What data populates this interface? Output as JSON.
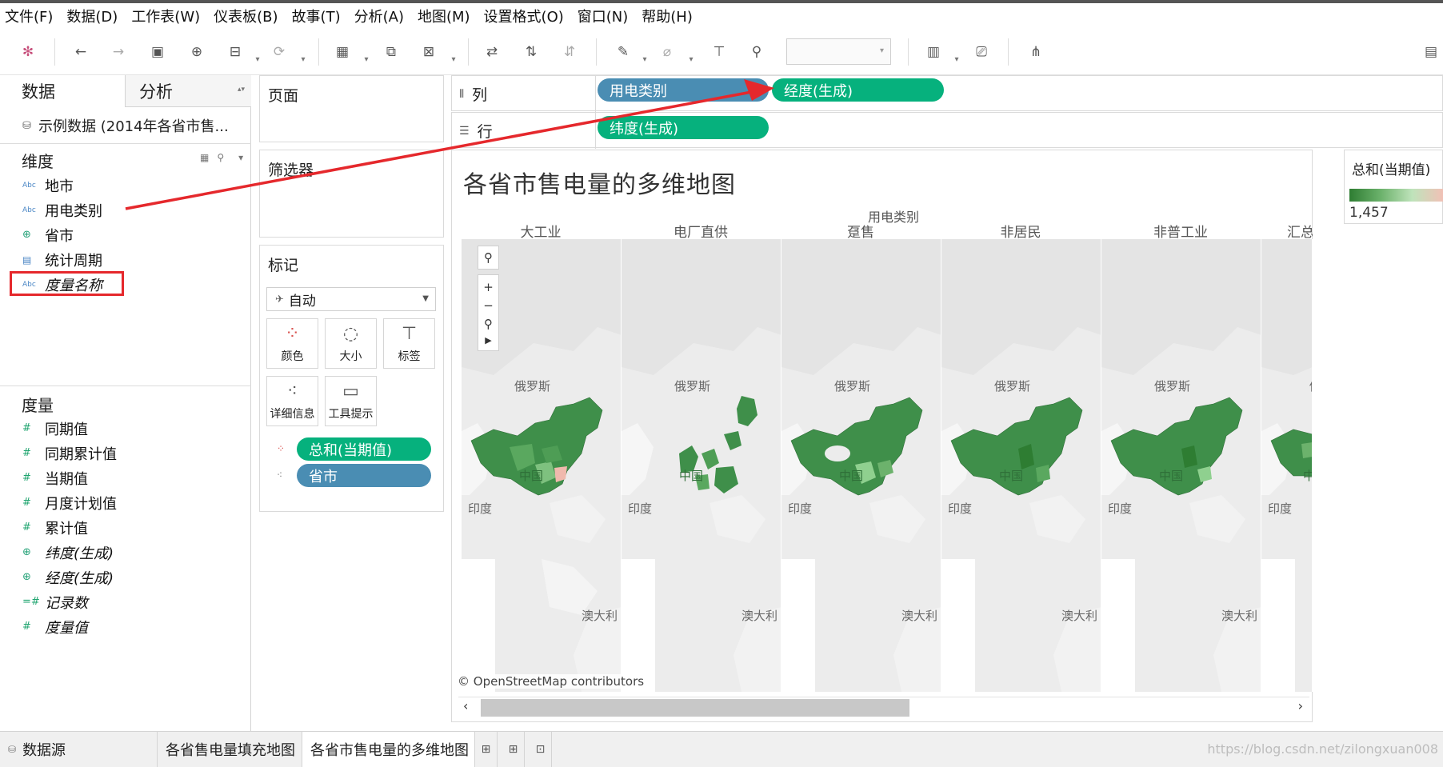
{
  "menu": [
    "文件(F)",
    "数据(D)",
    "工作表(W)",
    "仪表板(B)",
    "故事(T)",
    "分析(A)",
    "地图(M)",
    "设置格式(O)",
    "窗口(N)",
    "帮助(H)"
  ],
  "left_pane": {
    "tabs": {
      "data": "数据",
      "analysis": "分析"
    },
    "datasource": "示例数据 (2014年各省市售...",
    "dimensions_title": "维度",
    "dimensions": [
      {
        "label": "地市",
        "icon": "abc-string-icon"
      },
      {
        "label": "用电类别",
        "icon": "abc-string-icon"
      },
      {
        "label": "省市",
        "icon": "globe-icon"
      },
      {
        "label": "统计周期",
        "icon": "calendar-icon"
      },
      {
        "label": "度量名称",
        "icon": "abc-string-icon"
      }
    ],
    "measures_title": "度量",
    "measures": [
      {
        "label": "同期值",
        "icon": "number-icon"
      },
      {
        "label": "同期累计值",
        "icon": "number-icon"
      },
      {
        "label": "当期值",
        "icon": "number-icon"
      },
      {
        "label": "月度计划值",
        "icon": "number-icon"
      },
      {
        "label": "累计值",
        "icon": "number-icon"
      },
      {
        "label": "纬度(生成)",
        "icon": "globe-icon"
      },
      {
        "label": "经度(生成)",
        "icon": "globe-icon"
      },
      {
        "label": "记录数",
        "icon": "number-icon"
      },
      {
        "label": "度量值",
        "icon": "number-icon"
      }
    ]
  },
  "cards": {
    "pages": "页面",
    "filters": "筛选器",
    "marks": "标记",
    "mark_type": "自动",
    "mark_buttons": {
      "color": "颜色",
      "size": "大小",
      "label": "标签",
      "detail": "详细信息",
      "tooltip": "工具提示"
    },
    "mark_pills": {
      "color": "总和(当期值)",
      "detail": "省市"
    }
  },
  "shelves": {
    "columns_label": "列",
    "rows_label": "行",
    "columns_pills": [
      "用电类别",
      "经度(生成)"
    ],
    "rows_pills": [
      "纬度(生成)"
    ]
  },
  "view": {
    "title": "各省市售电量的多维地图",
    "column_header_title": "用电类别",
    "panels": [
      {
        "header": "大工业",
        "russia": "俄罗斯",
        "india": "印度",
        "china": "中国",
        "australia": "澳大利"
      },
      {
        "header": "电厂直供",
        "russia": "俄罗斯",
        "india": "印度",
        "china": "中国",
        "australia": "澳大利"
      },
      {
        "header": "趸售",
        "russia": "俄罗斯",
        "india": "印度",
        "china": "中国",
        "australia": "澳大利"
      },
      {
        "header": "非居民",
        "russia": "俄罗斯",
        "india": "印度",
        "china": "中国",
        "australia": "澳大利"
      },
      {
        "header": "非普工业",
        "russia": "俄罗斯",
        "india": "印度",
        "china": "中国",
        "australia": "澳大利"
      },
      {
        "header": "汇总",
        "russia": "俄",
        "india": "印度",
        "china": "中",
        "australia": ""
      }
    ],
    "attribution": "© OpenStreetMap contributors"
  },
  "legend": {
    "title": "总和(当期值)",
    "value": "1,457"
  },
  "bottom_tabs": {
    "datasource": "数据源",
    "sheet1": "各省售电量填充地图",
    "sheet2": "各省市售电量的多维地图"
  },
  "watermark": "https://blog.csdn.net/zilongxuan008",
  "colors": {
    "pill_green": "#06b17d",
    "pill_blue": "#4a8db3",
    "annotation_red": "#e5282c",
    "map_fill": "#3f8f4a"
  }
}
